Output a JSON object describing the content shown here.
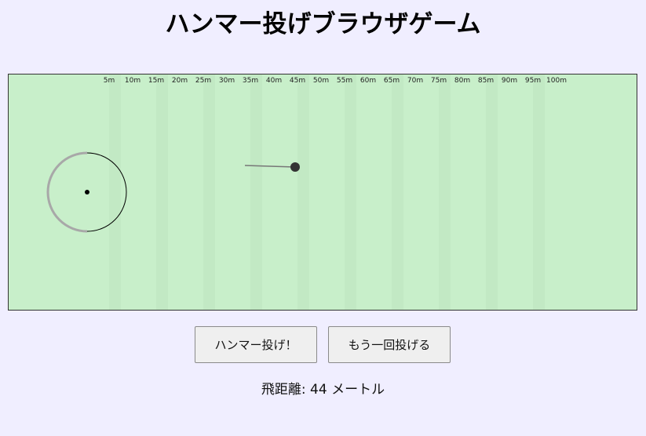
{
  "title": "ハンマー投げブラウザゲーム",
  "field": {
    "distance_labels": [
      "5m",
      "10m",
      "15m",
      "20m",
      "25m",
      "30m",
      "35m",
      "40m",
      "45m",
      "50m",
      "55m",
      "60m",
      "65m",
      "70m",
      "75m",
      "80m",
      "85m",
      "90m",
      "95m",
      "100m"
    ],
    "colors": {
      "grass": "#c8efca",
      "stripe": "#c2e9c4",
      "circle_outline": "#000000",
      "circle_used_arc": "#a8a8a8",
      "hammer_ball": "#333333",
      "wire": "#777777"
    }
  },
  "buttons": {
    "throw_label": "ハンマー投げ！",
    "retry_label": "もう一回投げる"
  },
  "result": {
    "text": "飛距離: 44 メートル"
  }
}
